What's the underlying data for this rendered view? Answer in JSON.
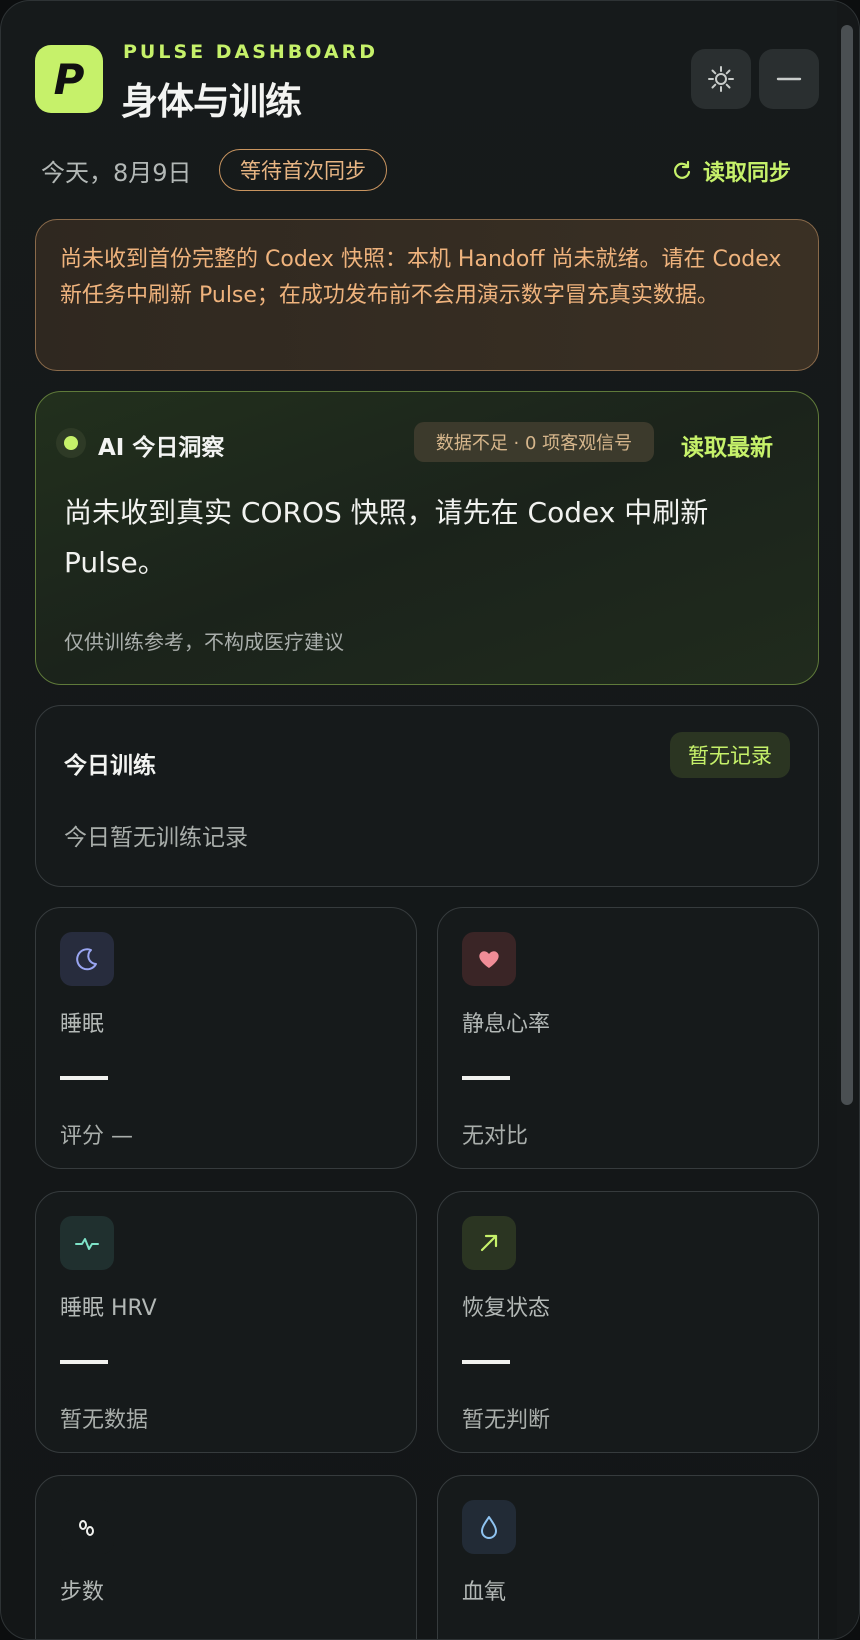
{
  "header": {
    "logo_letter": "P",
    "brand": "PULSE DASHBOARD",
    "title": "身体与训练",
    "settings_icon": "gear-icon",
    "minimize_icon": "minimize-icon"
  },
  "status_row": {
    "date": "今天，8月9日",
    "sync_status": "等待首次同步",
    "sync_button": "读取同步",
    "sync_icon": "refresh-icon"
  },
  "warning": {
    "text": "尚未收到首份完整的 Codex 快照：本机 Handoff 尚未就绪。请在 Codex 新任务中刷新 Pulse；在成功发布前不会用演示数字冒充真实数据。"
  },
  "insight": {
    "title": "AI 今日洞察",
    "data_badge": "数据不足 · 0 项客观信号",
    "action": "读取最新",
    "text": "尚未收到真实 COROS 快照，请先在 Codex 中刷新 Pulse。",
    "footnote": "仅供训练参考，不构成医疗建议"
  },
  "training": {
    "title": "今日训练",
    "badge": "暂无记录",
    "empty_text": "今日暂无训练记录"
  },
  "metrics": [
    {
      "label": "睡眠",
      "sub": "评分 —",
      "icon": "moon-icon",
      "icon_bg": "#272c3d",
      "icon_color": "#9aa6f2"
    },
    {
      "label": "静息心率",
      "sub": "无对比",
      "icon": "heart-icon",
      "icon_bg": "#3a2526",
      "icon_color": "#f08d97"
    },
    {
      "label": "睡眠 HRV",
      "sub": "暂无数据",
      "icon": "pulse-icon",
      "icon_bg": "#20302f",
      "icon_color": "#7ee3c8"
    },
    {
      "label": "恢复状态",
      "sub": "暂无判断",
      "icon": "arrow-up-right-icon",
      "icon_bg": "#2b3522",
      "icon_color": "#c6f16a"
    },
    {
      "label": "步数",
      "sub": "",
      "icon": "footsteps-icon",
      "icon_bg": "#161a1b",
      "icon_color": "#f1f2ef"
    },
    {
      "label": "血氧",
      "sub": "",
      "icon": "droplet-icon",
      "icon_bg": "#222b36",
      "icon_color": "#8fc3f0"
    }
  ]
}
